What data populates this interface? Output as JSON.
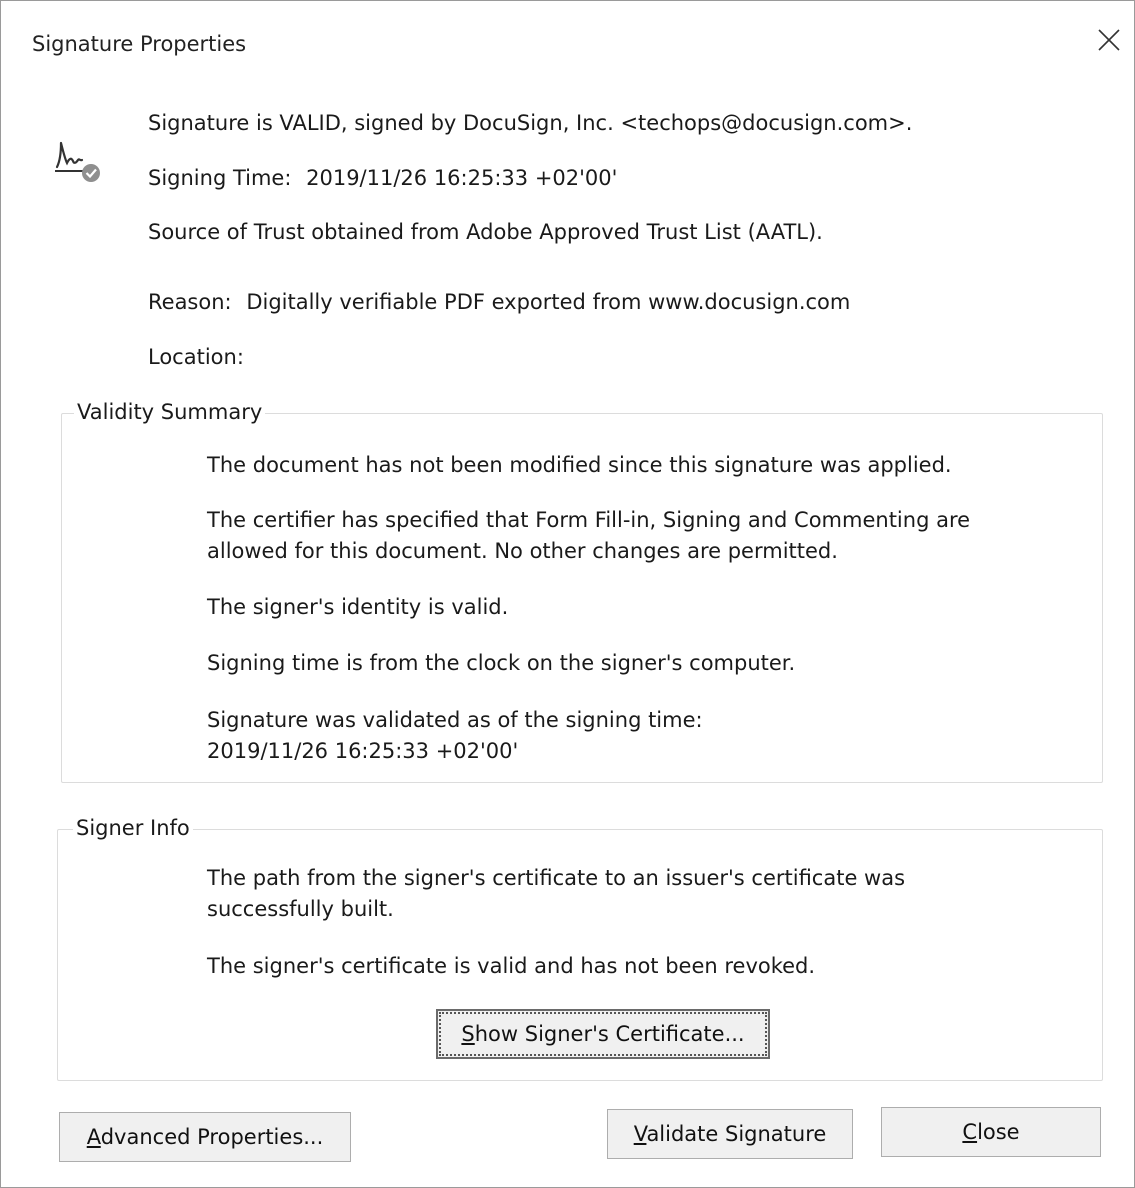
{
  "window": {
    "title": "Signature Properties"
  },
  "signature": {
    "status": "Signature is VALID, signed by DocuSign, Inc. <techops@docusign.com>.",
    "signing_time_label": "Signing Time:",
    "signing_time_value": "2019/11/26 16:25:33 +02'00'",
    "trust_source": "Source of Trust obtained from Adobe Approved Trust List (AATL).",
    "reason_label": "Reason:",
    "reason_value": "Digitally verifiable PDF exported from www.docusign.com",
    "location_label": "Location:",
    "location_value": ""
  },
  "validity_summary": {
    "label": "Validity Summary",
    "items": [
      "The document has not been modified since this signature was applied.",
      "The certifier has specified that Form Fill-in, Signing and Commenting are allowed for this document. No other changes are permitted.",
      "The signer's identity is valid.",
      "Signing time is from the clock on the signer's computer.",
      "Signature was validated as of the signing time:",
      "2019/11/26 16:25:33 +02'00'"
    ]
  },
  "signer_info": {
    "label": "Signer Info",
    "items": [
      "The path from the signer's certificate to an issuer's certificate was successfully built.",
      "The signer's certificate is valid and has not been revoked."
    ],
    "show_certificate_button": {
      "mnemonic": "S",
      "rest": "how Signer's Certificate..."
    }
  },
  "buttons": {
    "advanced": {
      "mnemonic": "A",
      "rest": "dvanced Properties..."
    },
    "validate": {
      "mnemonic": "V",
      "rest": "alidate Signature"
    },
    "close": {
      "mnemonic": "C",
      "rest": "lose"
    }
  },
  "icons": {
    "signature": "signature-validated-icon",
    "close": "close-icon"
  }
}
